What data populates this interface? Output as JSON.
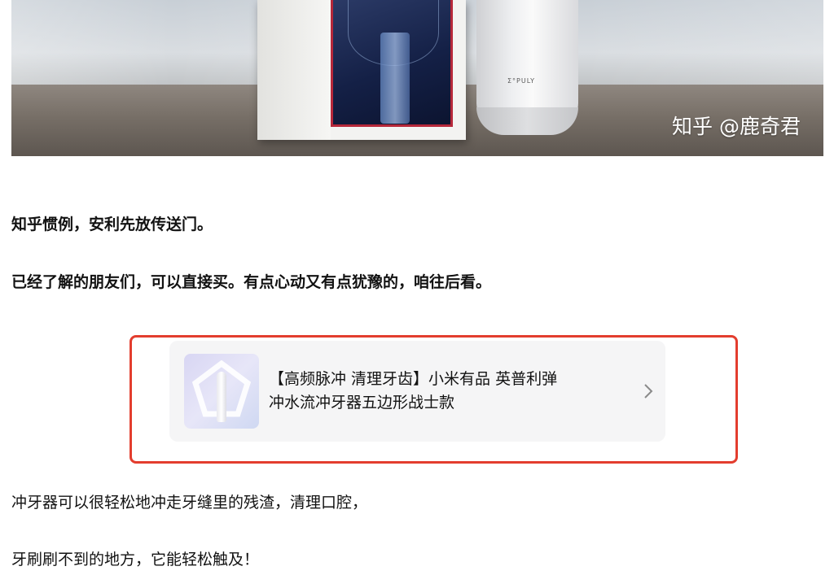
{
  "hero": {
    "watermark": "知乎 @鹿奇君",
    "bottle_brand": "Σ°PULY"
  },
  "article": {
    "p1": "知乎惯例，安利先放传送门。",
    "p2": "已经了解的朋友们，可以直接买。有点心动又有点犹豫的，咱往后看。",
    "p3": "冲牙器可以很轻松地冲走牙缝里的残渣，清理口腔，",
    "p4": "牙刷刷不到的地方，它能轻松触及！"
  },
  "product_card": {
    "title_line1": "【高频脉冲 清理牙齿】小米有品 英普利弹",
    "title_line2": "冲水流冲牙器五边形战士款",
    "chevron_icon": "chevron-right-icon",
    "highlight_color": "#e33d2e"
  }
}
